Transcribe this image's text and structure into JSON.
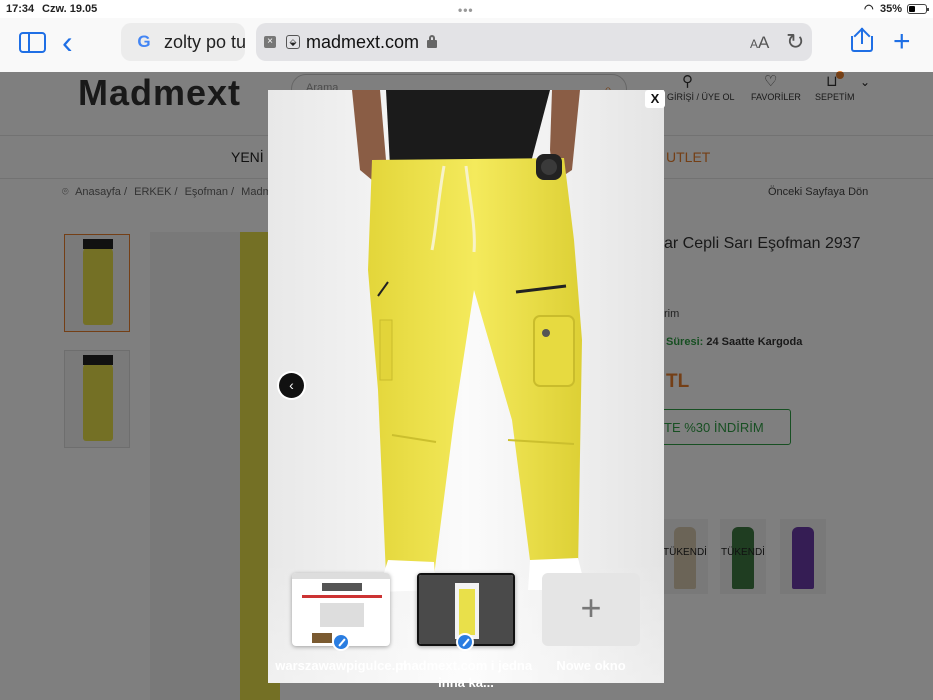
{
  "status_bar": {
    "time": "17:34",
    "date": "Czw. 19.05",
    "battery": "35%"
  },
  "safari": {
    "other_tab_title": "zolty po tu",
    "url": "madmext.com",
    "text_size_label": "AA"
  },
  "site": {
    "logo": "Madmext",
    "search_placeholder": "Arama",
    "header_links": {
      "login": "GİRİŞİ / ÜYE OL",
      "favorites": "FAVORİLER",
      "cart": "SEPETİM"
    },
    "nav": {
      "new": "YENİ Ü",
      "outlet": "UTLET"
    },
    "breadcrumb": [
      "Anasayfa /",
      "ERKEK /",
      "Eşofman /",
      "Madm"
    ],
    "previous_page": "Önceki Sayfaya Dön",
    "product_title": "ar Cepli Sarı Eşofman 2937",
    "line_discount": "rim",
    "shipping": {
      "label": "Süresi:",
      "value": "24 Saatte Kargoda"
    },
    "price": "TL",
    "discount_button": "TE %30 İNDİRİM",
    "variants": [
      {
        "label": "TÜKENDİ",
        "color": "#d7c9ae"
      },
      {
        "label": "TÜKENDİ",
        "color": "#3f7a43"
      },
      {
        "label": "",
        "color": "#6a3aa8"
      }
    ]
  },
  "modal": {
    "close_label": "X",
    "prev_label": "‹"
  },
  "tab_switcher": {
    "tabs": [
      {
        "label": "warszawawpigulce.pl"
      },
      {
        "label": "madmext.com i jedna inna ka..."
      }
    ],
    "new_window_label": "Nowe okno"
  },
  "colors": {
    "brand_orange": "#e87f2c",
    "safari_blue": "#1f6fe5",
    "pants_yellow": "#e9e04a"
  }
}
